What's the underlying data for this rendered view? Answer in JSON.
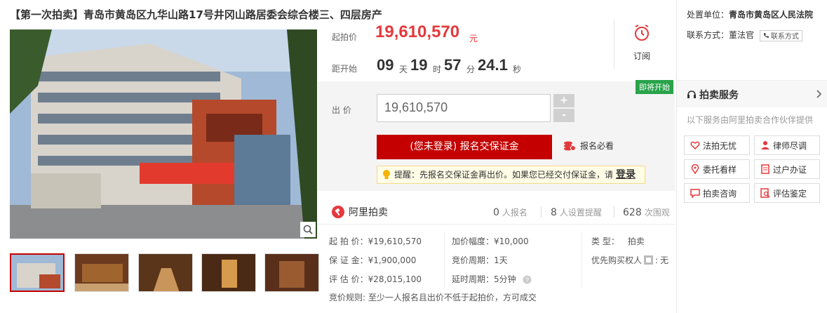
{
  "title": "【第一次拍卖】青岛市黄岛区九华山路17号井冈山路居委会综合楼三、四层房产",
  "price": {
    "start_label": "起拍价",
    "start_value": "19,610,570",
    "start_unit": "元",
    "countdown_label": "距开始",
    "days": "09",
    "days_unit": "天",
    "hours": "19",
    "hours_unit": "时",
    "minutes": "57",
    "minutes_unit": "分",
    "seconds": "24.1",
    "seconds_unit": "秒",
    "subscribe_label": "订阅"
  },
  "bid": {
    "status_badge": "即将开始",
    "bid_label": "出 价",
    "bid_value": "19,610,570",
    "plus": "+",
    "minus": "-",
    "register_button": "(您未登录) 报名交保证金",
    "must_read": "报名必看",
    "tip_text": "提醒：先报名交保证金再出价。如果您已经交付保证金，请",
    "tip_login": "登录"
  },
  "stats": {
    "brand": "阿里拍卖",
    "registered_count": "0",
    "registered_label": "人报名",
    "reminder_count": "8",
    "reminder_label": "人设置提醒",
    "views_count": "628",
    "views_label": "次围观"
  },
  "details": {
    "start_price": "起 拍 价：¥19,610,570",
    "deposit": "保 证 金：¥1,900,000",
    "appraisal": "评 估 价：¥28,015,100",
    "increment": "加价幅度：¥10,000",
    "bid_cycle": "竞价周期：1天",
    "delay_cycle": "延时周期：5分钟",
    "type_label": "类      型：",
    "type_value": "拍卖",
    "priority_label": "优先购买权人",
    "priority_value": "无",
    "rule": "竞价规则:   至少一人报名且出价不低于起拍价，方可成交"
  },
  "right": {
    "court_label": "处置单位：",
    "court_value": "青岛市黄岛区人民法院",
    "contact_label": "联系方式：董法官",
    "contact_button": "联系方式",
    "service_title": "拍卖服务",
    "service_sub": "以下服务由阿里拍卖合作伙伴提供",
    "services": [
      "法拍无忧",
      "律师尽调",
      "委托看样",
      "过户办证",
      "拍卖咨询",
      "评估鉴定"
    ]
  },
  "colors": {
    "accent_red": "#c40000",
    "price_red": "#e4393c",
    "badge_green": "#29a34a"
  }
}
